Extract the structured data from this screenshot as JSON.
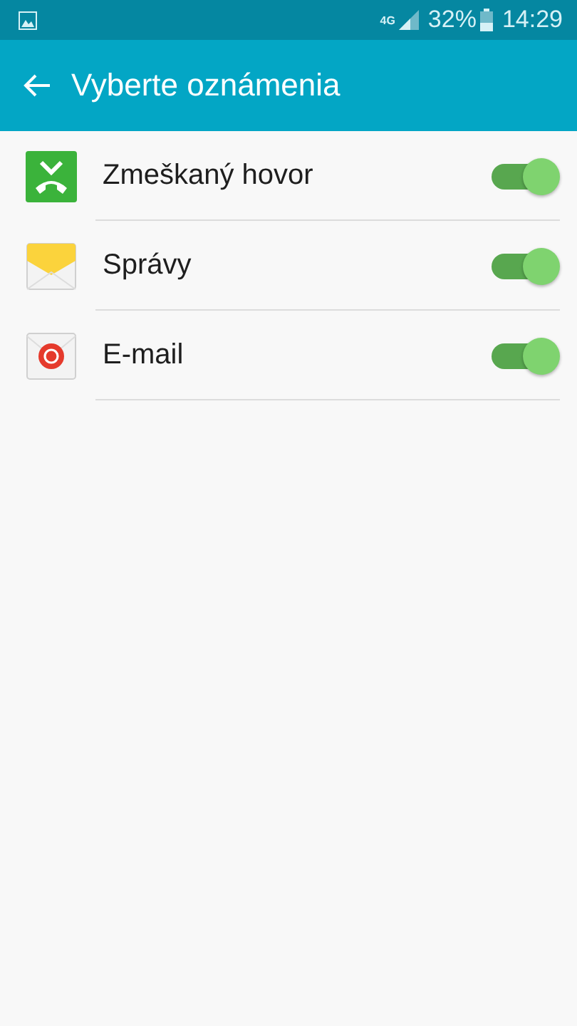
{
  "status_bar": {
    "network": "4G",
    "battery": "32%",
    "time": "14:29"
  },
  "app_bar": {
    "title": "Vyberte oznámenia"
  },
  "items": [
    {
      "kind": "missed_call",
      "label": "Zmeškaný hovor",
      "on": true
    },
    {
      "kind": "messages",
      "label": "Správy",
      "on": true
    },
    {
      "kind": "email",
      "label": "E-mail",
      "on": true
    }
  ]
}
